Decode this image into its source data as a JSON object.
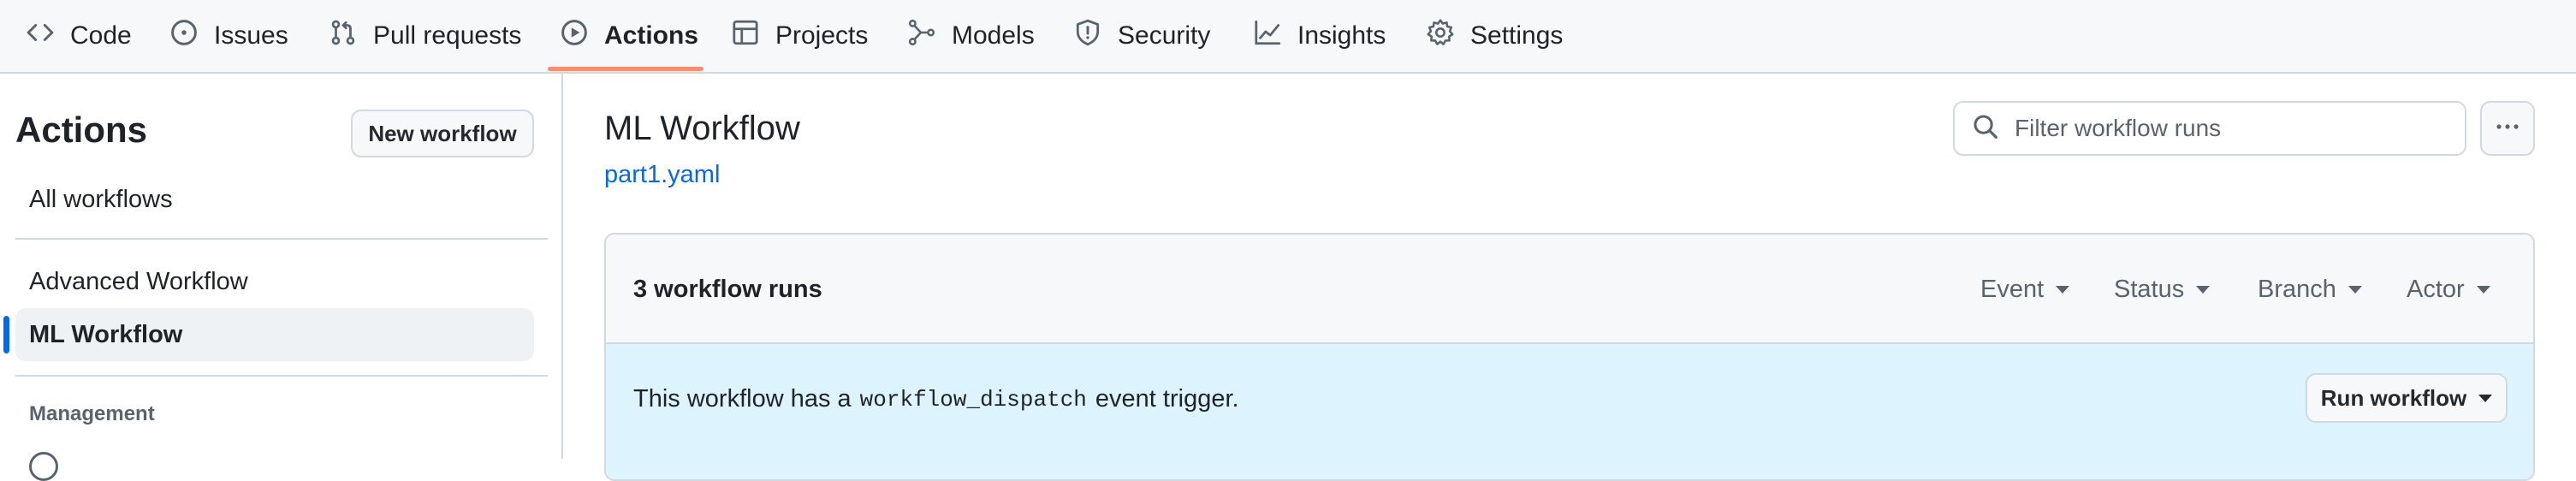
{
  "nav": {
    "tabs": [
      {
        "label": "Code",
        "icon": "code-icon",
        "active": false
      },
      {
        "label": "Issues",
        "icon": "issue-opened-icon",
        "active": false
      },
      {
        "label": "Pull requests",
        "icon": "git-pull-request-icon",
        "active": false
      },
      {
        "label": "Actions",
        "icon": "play-icon",
        "active": true
      },
      {
        "label": "Projects",
        "icon": "table-icon",
        "active": false
      },
      {
        "label": "Models",
        "icon": "models-icon",
        "active": false
      },
      {
        "label": "Security",
        "icon": "shield-icon",
        "active": false
      },
      {
        "label": "Insights",
        "icon": "graph-icon",
        "active": false
      },
      {
        "label": "Settings",
        "icon": "gear-icon",
        "active": false
      }
    ],
    "active_underline_color": "#fd8c73"
  },
  "sidebar": {
    "title": "Actions",
    "new_workflow_label": "New workflow",
    "all_workflows_label": "All workflows",
    "workflows": [
      {
        "label": "Advanced Workflow",
        "selected": false
      },
      {
        "label": "ML Workflow",
        "selected": true
      }
    ],
    "management_heading": "Management",
    "selection_indicator_color": "#0969da"
  },
  "main": {
    "title": "ML Workflow",
    "file_link": "part1.yaml",
    "search": {
      "placeholder": "Filter workflow runs",
      "value": ""
    },
    "more_menu_icon": "kebab-horizontal-icon",
    "runs": {
      "count_label": "3 workflow runs",
      "filters": [
        "Event",
        "Status",
        "Branch",
        "Actor"
      ]
    },
    "dispatch_banner": {
      "text_before": "This workflow has a",
      "code": "workflow_dispatch",
      "text_after": "event trigger.",
      "run_button_label": "Run workflow",
      "background_color": "#ddf4ff"
    }
  }
}
